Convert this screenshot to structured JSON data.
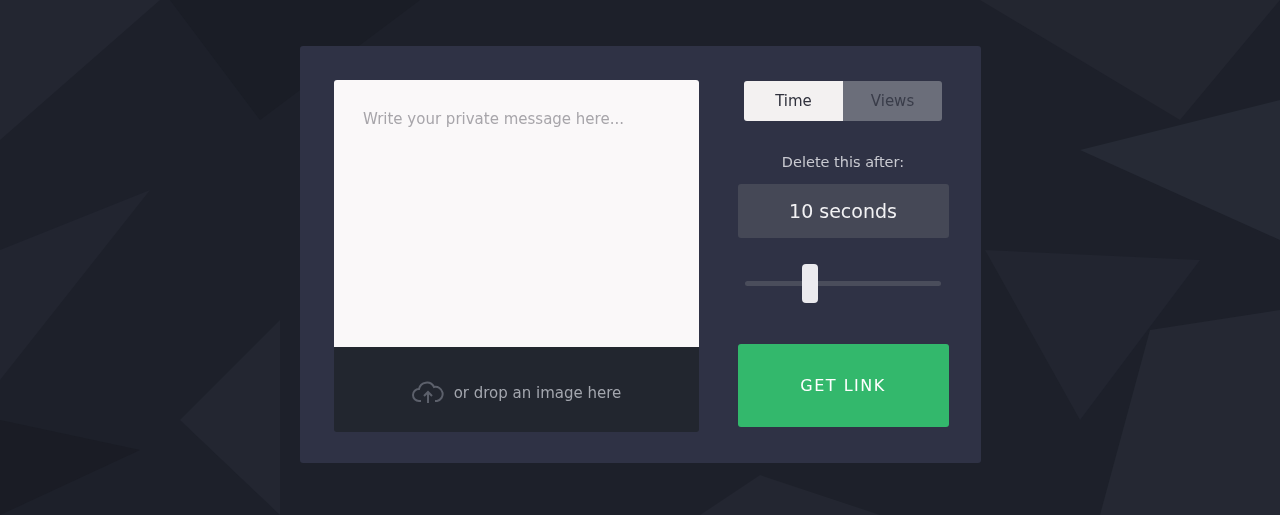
{
  "message": {
    "placeholder": "Write your private message here..."
  },
  "drop_zone": {
    "label": "or drop an image here"
  },
  "tabs": [
    {
      "label": "Time",
      "selected": true
    },
    {
      "label": "Views",
      "selected": false
    }
  ],
  "delete_label": "Delete this after:",
  "duration": {
    "value": "10 seconds"
  },
  "slider": {
    "level": 0.33
  },
  "button": {
    "label": "GET LINK"
  }
}
